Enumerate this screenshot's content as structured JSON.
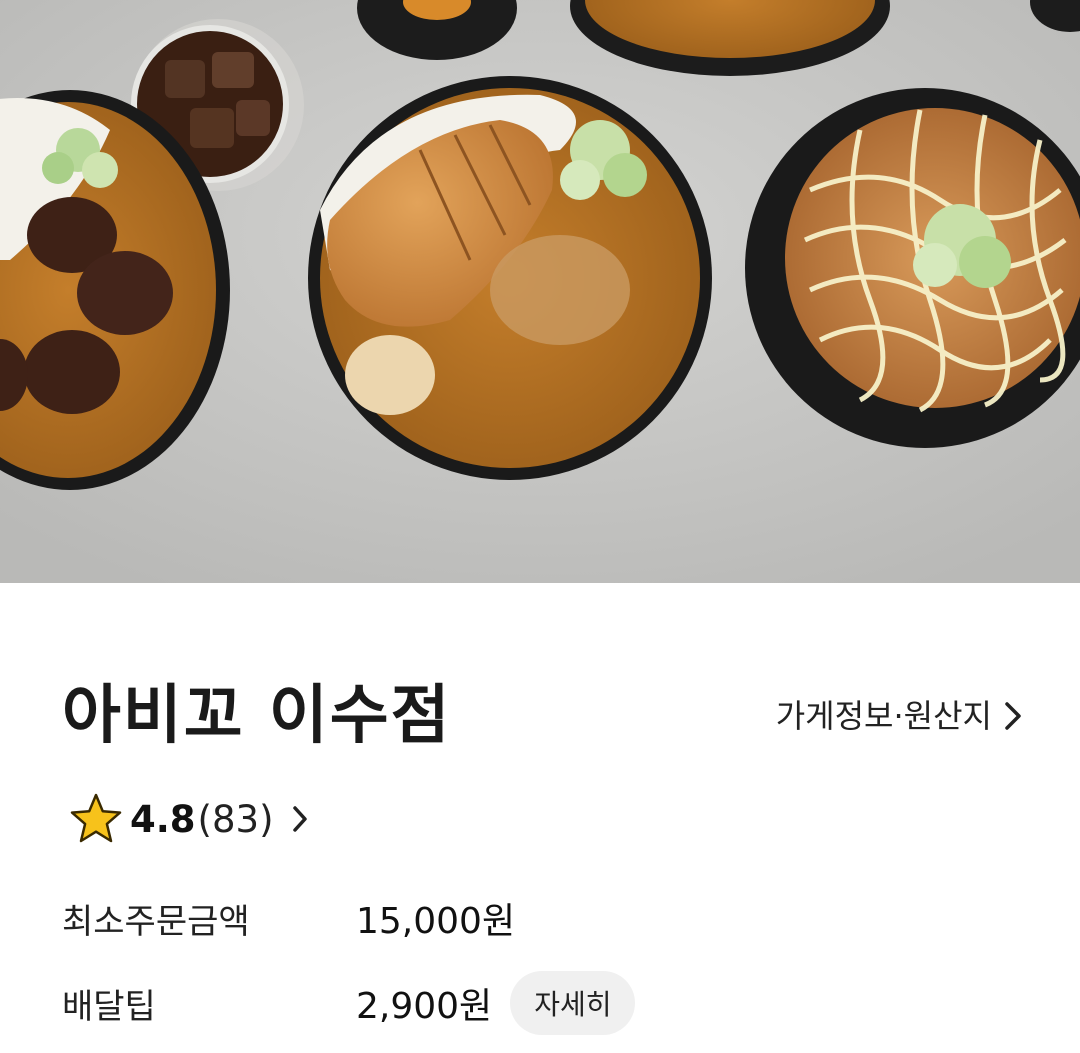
{
  "store": {
    "name": "아비꼬 이수점",
    "info_link": "가게정보·원산지"
  },
  "rating": {
    "score": "4.8",
    "count": "(83)"
  },
  "details": {
    "min_order_label": "최소주문금액",
    "min_order_value": "15,000원",
    "delivery_tip_label": "배달팁",
    "delivery_tip_value": "2,900원",
    "detail_button": "자세히"
  },
  "colors": {
    "star": "#F7C21B",
    "background": "#FFFFFF",
    "button_bg": "#F0F0F0"
  }
}
